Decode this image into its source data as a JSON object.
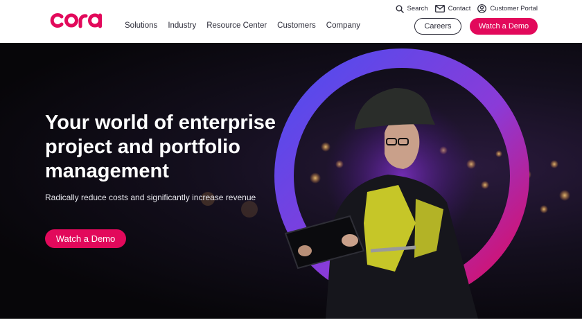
{
  "brand": {
    "logo_text": "cora",
    "accent_color": "#e2095b"
  },
  "utility_nav": [
    {
      "label": "Search",
      "icon": "search-icon"
    },
    {
      "label": "Contact",
      "icon": "mail-icon"
    },
    {
      "label": "Customer Portal",
      "icon": "user-circle-icon"
    }
  ],
  "main_nav": [
    "Solutions",
    "Industry",
    "Resource Center",
    "Customers",
    "Company"
  ],
  "header_buttons": {
    "careers": "Careers",
    "watch_demo": "Watch a Demo"
  },
  "hero": {
    "title": "Your world of enterprise project and portfolio management",
    "subtitle": "Radically reduce costs and significantly increase revenue",
    "cta": "Watch a Demo",
    "image": "engineer-with-tablet-in-ring-illustration"
  }
}
